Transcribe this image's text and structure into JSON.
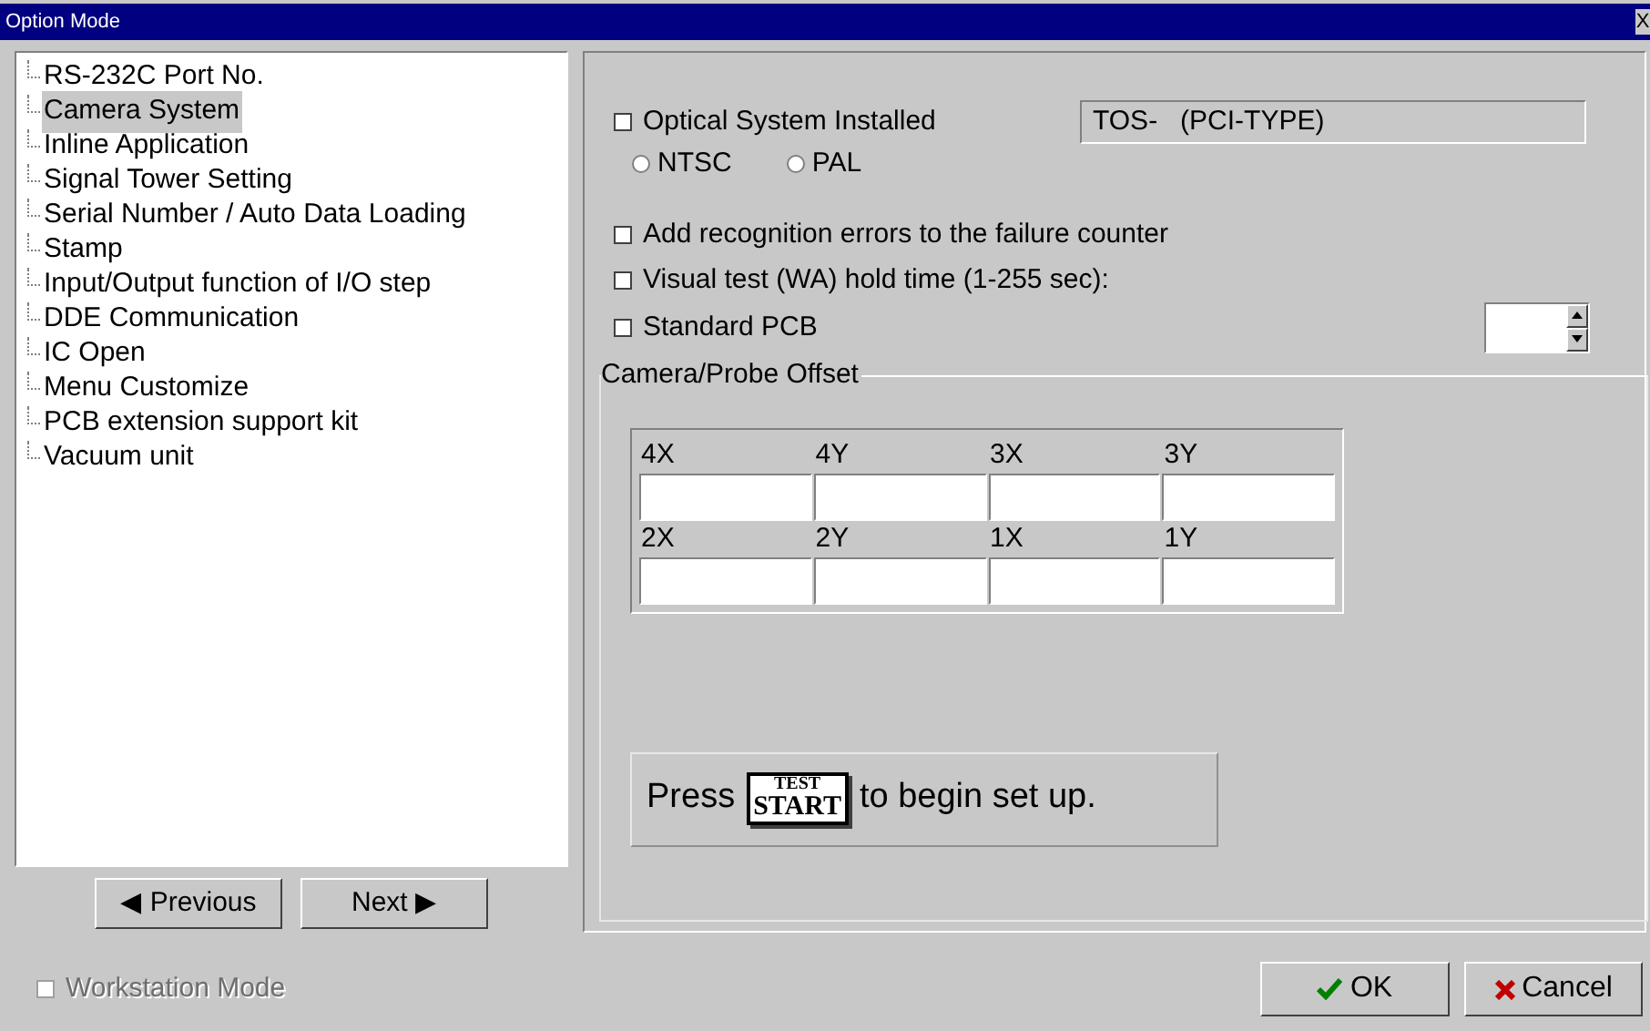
{
  "window": {
    "title": "Option Mode",
    "close": "X"
  },
  "tree": {
    "items": [
      {
        "label": "RS-232C Port No.",
        "selected": false
      },
      {
        "label": "Camera System",
        "selected": true
      },
      {
        "label": "Inline Application",
        "selected": false
      },
      {
        "label": "Signal Tower Setting",
        "selected": false
      },
      {
        "label": "Serial Number / Auto Data Loading",
        "selected": false
      },
      {
        "label": "Stamp",
        "selected": false
      },
      {
        "label": "Input/Output function of I/O step",
        "selected": false
      },
      {
        "label": "DDE Communication",
        "selected": false
      },
      {
        "label": "IC Open",
        "selected": false
      },
      {
        "label": "Menu Customize",
        "selected": false
      },
      {
        "label": "PCB extension support kit",
        "selected": false
      },
      {
        "label": "Vacuum unit",
        "selected": false
      }
    ]
  },
  "nav": {
    "previous": "◀ Previous",
    "next": "Next ▶"
  },
  "options": {
    "optical": {
      "label": "Optical System Installed",
      "checked": false
    },
    "system_type": "TOS-   (PCI-TYPE)",
    "video": [
      {
        "label": "NTSC",
        "selected": false
      },
      {
        "label": "PAL",
        "selected": false
      }
    ],
    "add_errors": {
      "label": "Add recognition errors to the failure counter",
      "checked": false
    },
    "hold_time": {
      "label": "Visual test (WA) hold time (1-255 sec):",
      "checked": false
    },
    "standard_pcb": {
      "label": "Standard PCB",
      "checked": false
    }
  },
  "offset": {
    "title": "Camera/Probe Offset",
    "fields": [
      "4X",
      "4Y",
      "3X",
      "3Y",
      "2X",
      "2Y",
      "1X",
      "1Y"
    ]
  },
  "hint": {
    "before": "Press",
    "key_top": "TEST",
    "key_bottom": "START",
    "after": "to begin set up."
  },
  "footer": {
    "workstation": {
      "label": "Workstation Mode",
      "checked": false,
      "disabled": true
    },
    "ok": "OK",
    "cancel": "Cancel"
  }
}
